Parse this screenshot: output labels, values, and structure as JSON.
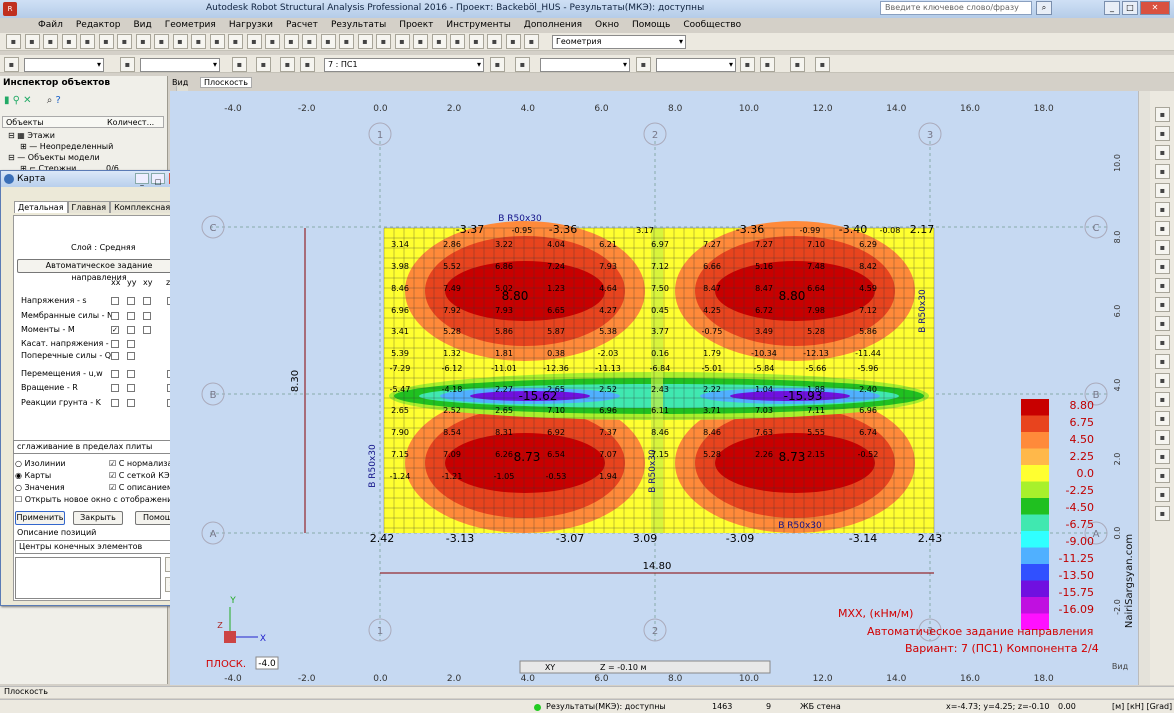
{
  "window": {
    "title": "Autodesk Robot Structural Analysis Professional 2016 - Проект: Backeböl_HUS - Результаты(МКЭ): доступны",
    "search_placeholder": "Введите ключевое слово/фразу"
  },
  "menu": [
    "Файл",
    "Редактор",
    "Вид",
    "Геометрия",
    "Нагрузки",
    "Расчет",
    "Результаты",
    "Проект",
    "Инструменты",
    "Дополнения",
    "Окно",
    "Помощь",
    "Сообщество"
  ],
  "toolbar": {
    "geometry_combo": "Геометрия",
    "case_combo": "7 : ПС1"
  },
  "inspector": {
    "title": "Инспектор объектов",
    "col_objects": "Объекты",
    "col_count": "Количест...",
    "tree": [
      "Этажи",
      "Неопределенный",
      "Объекты модели",
      "Стержни"
    ],
    "tree_count": "0/6"
  },
  "karta": {
    "title": "Карта",
    "tabs": [
      "Детальная",
      "Главная",
      "Комплексная"
    ],
    "layer": "Слой : Средняя",
    "auto_button": "Автоматическое задание направления",
    "cols": [
      "xx",
      "yy",
      "xy",
      "z"
    ],
    "rows": [
      "Напряжения - s",
      "Мембранные силы - N",
      "Моменты - M",
      "Касат. напряжения - t",
      "Поперечные силы - Q",
      "Перемещения - u,w",
      "Вращение - R",
      "Реакции грунта - K"
    ],
    "smoothing": "сглаживание в пределах плиты",
    "radio": [
      "Изолинии",
      "Карты",
      "Значения"
    ],
    "checks": [
      "С нормализацией",
      "С сеткой КЭ",
      "С описанием"
    ],
    "open_new": "Открыть новое окно с отображением масшт",
    "apply": "Применить",
    "close": "Закрыть",
    "help": "Помощь",
    "desc_label": "Описание позиций",
    "desc_combo": "Центры конечных элементов"
  },
  "view_tabs": [
    "Вид",
    "Плоскость"
  ],
  "axis_x": [
    "-4.0",
    "-2.0",
    "0.0",
    "2.0",
    "4.0",
    "6.0",
    "8.0",
    "10.0",
    "12.0",
    "14.0",
    "16.0",
    "18.0"
  ],
  "axis_y": [
    "10.0",
    "8.0",
    "6.0",
    "4.0",
    "2.0",
    "0.0",
    "-2.0"
  ],
  "grid_cols": [
    "1",
    "2",
    "3"
  ],
  "grid_rows": [
    "C",
    "B",
    "A"
  ],
  "dims": {
    "height": "8.30",
    "width": "14.80"
  },
  "beams": [
    "B R50x30",
    "B R50x30",
    "B R50x30",
    "B R50x30",
    "B R50x30"
  ],
  "values": {
    "top": [
      "-3.37",
      "-0.95",
      "-3.36",
      "3.17",
      "-3.36",
      "-0.99",
      "-3.40",
      "-0.08",
      "2.17"
    ],
    "corners": [
      "2.42",
      "-3.13",
      "-3.07",
      "3.09",
      "-3.09",
      "-3.14",
      "2.43"
    ],
    "peaks": [
      "8.80",
      "8.80",
      "-15.62",
      "-15.93",
      "8.73",
      "8.73"
    ],
    "mid": [
      "3.14",
      "2.86",
      "3.22",
      "4.04",
      "6.21",
      "6.97",
      "7.27",
      "7.27",
      "7.10",
      "6.29",
      "3.98",
      "5.52",
      "6.86",
      "7.24",
      "7.93",
      "7.12",
      "6.66",
      "5.16",
      "7.48",
      "8.42",
      "8.46",
      "7.49",
      "5.02",
      "1.23",
      "4.64",
      "7.50",
      "8.47",
      "8.47",
      "6.64",
      "4.59",
      "6.96",
      "7.92",
      "7.93",
      "6.65",
      "4.27",
      "0.45",
      "4.25",
      "6.72",
      "7.98",
      "7.12",
      "3.41",
      "5.28",
      "5.86",
      "5.87",
      "5.38",
      "3.77",
      "-0.75",
      "3.49",
      "5.28",
      "5.86",
      "5.39",
      "1.32",
      "1.81",
      "0.38",
      "-2.03",
      "0.16",
      "1.79",
      "-10.34",
      "-12.13",
      "-11.44",
      "-7.29",
      "-6.12",
      "-11.01",
      "-12.36",
      "-11.13",
      "-6.84",
      "-5.01",
      "-5.84",
      "-5.66",
      "-5.96",
      "-5.47",
      "-4.18",
      "2.27",
      "2.65",
      "2.52",
      "2.43",
      "2.22",
      "1.04",
      "1.88",
      "2.40",
      "2.65",
      "2.52",
      "2.65",
      "7.10",
      "6.96",
      "6.11",
      "3.71",
      "7.03",
      "7.11",
      "6.96",
      "7.90",
      "8.54",
      "8.31",
      "6.92",
      "7.37",
      "8.46",
      "8.46",
      "7.63",
      "5.55",
      "6.74",
      "7.15",
      "7.09",
      "6.26",
      "6.54",
      "7.07",
      "7.15",
      "5.28",
      "2.26",
      "2.15",
      "-0.52",
      "-1.24",
      "-1.21",
      "-1.05",
      "-0.53",
      "1.94"
    ]
  },
  "legend": {
    "colors": [
      "#c80000",
      "#e8441e",
      "#ff8a3a",
      "#ffb84a",
      "#ffff30",
      "#a8f02c",
      "#20c020",
      "#40e8b0",
      "#30ffff",
      "#50b0ff",
      "#3050ff",
      "#7010e0",
      "#c010e0",
      "#ff10ff"
    ],
    "labels": [
      "8.80",
      "6.75",
      "4.50",
      "2.25",
      "0.0",
      "-2.25",
      "-4.50",
      "-6.75",
      "-9.00",
      "-11.25",
      "-13.50",
      "-15.75",
      "-16.09"
    ]
  },
  "caption": {
    "line1": "MXX, (кНм/м)",
    "line2": "Автоматическое задание направления",
    "line3": "Вариант: 7 (ПС1) Компонента 2/4",
    "watermark": "NairiSargsyan.com"
  },
  "view_label": "ПЛОСК.",
  "view_val": "-4.0",
  "view_name": "Вид",
  "coord": {
    "plane": "XY",
    "z": "Z = -0.10 м"
  },
  "bottom_tab": "Плоскость",
  "status": {
    "results": "Результаты(МКЭ): доступны",
    "n1": "1463",
    "n2": "9",
    "type": "ЖБ стена",
    "xyz": "x=-4.73; y=4.25; z=-0.10",
    "val": "0.00",
    "units": "[м] [кН] [Grad]"
  }
}
